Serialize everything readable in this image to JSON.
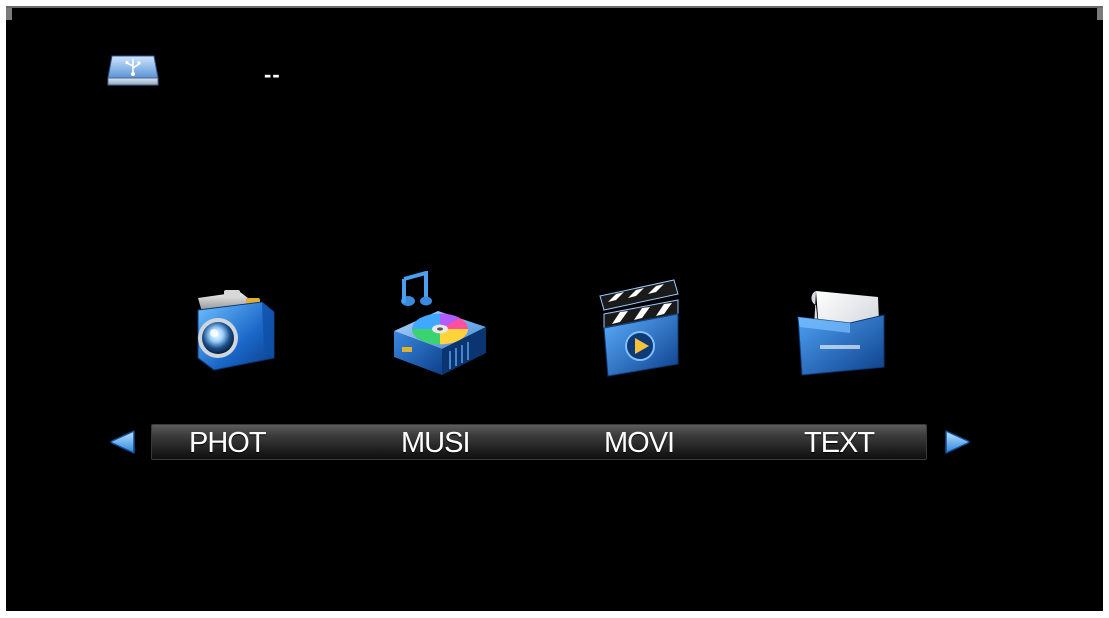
{
  "source": {
    "icon": "usb-drive-icon",
    "label": "--"
  },
  "menu": {
    "items": [
      {
        "label": "PHOT",
        "icon": "camera-icon"
      },
      {
        "label": "MUSI",
        "icon": "music-disc-icon"
      },
      {
        "label": "MOVI",
        "icon": "clapperboard-icon"
      },
      {
        "label": "TEXT",
        "icon": "document-folder-icon"
      }
    ],
    "prev_icon": "arrow-left-icon",
    "next_icon": "arrow-right-icon"
  },
  "colors": {
    "background": "#000000",
    "accent": "#2f8fe0",
    "text": "#ffffff"
  }
}
